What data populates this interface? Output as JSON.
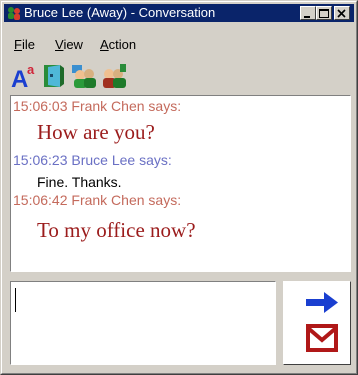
{
  "window": {
    "title": "Bruce Lee (Away) - Conversation"
  },
  "menu": {
    "items": [
      {
        "label": "File",
        "accel": "F",
        "rest": "ile"
      },
      {
        "label": "View",
        "accel": "V",
        "rest": "iew"
      },
      {
        "label": "Action",
        "accel": "A",
        "rest": "ction"
      }
    ]
  },
  "toolbar": {
    "icons": [
      "font-icon",
      "door-icon",
      "add-contact-icon",
      "remove-contact-icon"
    ]
  },
  "conversation": {
    "messages": [
      {
        "header": "15:06:03 Frank Chen says:",
        "text": "How are you?",
        "sender": "frank"
      },
      {
        "header": "15:06:23 Bruce Lee says:",
        "text": "Fine. Thanks.",
        "sender": "bruce"
      },
      {
        "header": "15:06:42 Frank Chen says:",
        "text": "To my office now?",
        "sender": "frank"
      }
    ]
  },
  "compose": {
    "value": ""
  },
  "colors": {
    "frank_header": "#c46a5c",
    "bruce_header": "#6a70c4",
    "frank_message": "#9b1c1c",
    "titlebar": "#0a246a"
  }
}
